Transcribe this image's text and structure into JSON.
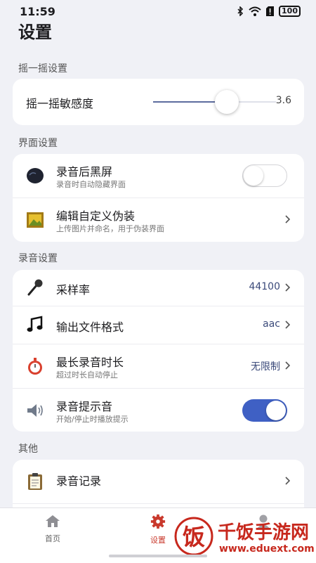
{
  "status": {
    "time": "11:59",
    "battery": "100"
  },
  "page": {
    "title": "设置"
  },
  "shake": {
    "section_title": "摇一摇设置",
    "sensitivity_label": "摇一摇敏感度",
    "sensitivity_value": "3.6",
    "sensitivity_fraction": 0.6
  },
  "interface": {
    "section_title": "界面设置",
    "black_screen": {
      "label": "录音后黑屏",
      "sub": "录音时自动隐藏界面",
      "enabled": false,
      "icon": "dark-screen-icon"
    },
    "disguise": {
      "label": "编辑自定义伪装",
      "sub": "上传图片并命名，用于伪装界面",
      "icon": "picture-frame-icon"
    }
  },
  "recording": {
    "section_title": "录音设置",
    "sample_rate": {
      "label": "采样率",
      "value": "44100",
      "icon": "microphone-icon"
    },
    "format": {
      "label": "输出文件格式",
      "value": "aac",
      "icon": "music-note-icon"
    },
    "max_duration": {
      "label": "最长录音时长",
      "sub": "超过时长自动停止",
      "value": "无限制",
      "icon": "stopwatch-icon"
    },
    "prompt_sound": {
      "label": "录音提示音",
      "sub": "开始/停止时播放提示",
      "enabled": true,
      "icon": "speaker-icon"
    }
  },
  "other": {
    "section_title": "其他",
    "records": {
      "label": "录音记录",
      "icon": "clipboard-icon"
    }
  },
  "nav": {
    "home": {
      "label": "首页",
      "icon": "home-icon"
    },
    "settings": {
      "label": "设置",
      "icon": "gear-icon"
    },
    "profile": {
      "icon": "person-icon"
    }
  },
  "watermark": {
    "brand": "千饭手游网",
    "url": "www.eduext.com",
    "logo_char": "饭"
  },
  "colors": {
    "accent": "#3f60c4",
    "active_nav": "#c9392c",
    "value_text": "#3b4a7a",
    "background": "#f0f1f6"
  }
}
